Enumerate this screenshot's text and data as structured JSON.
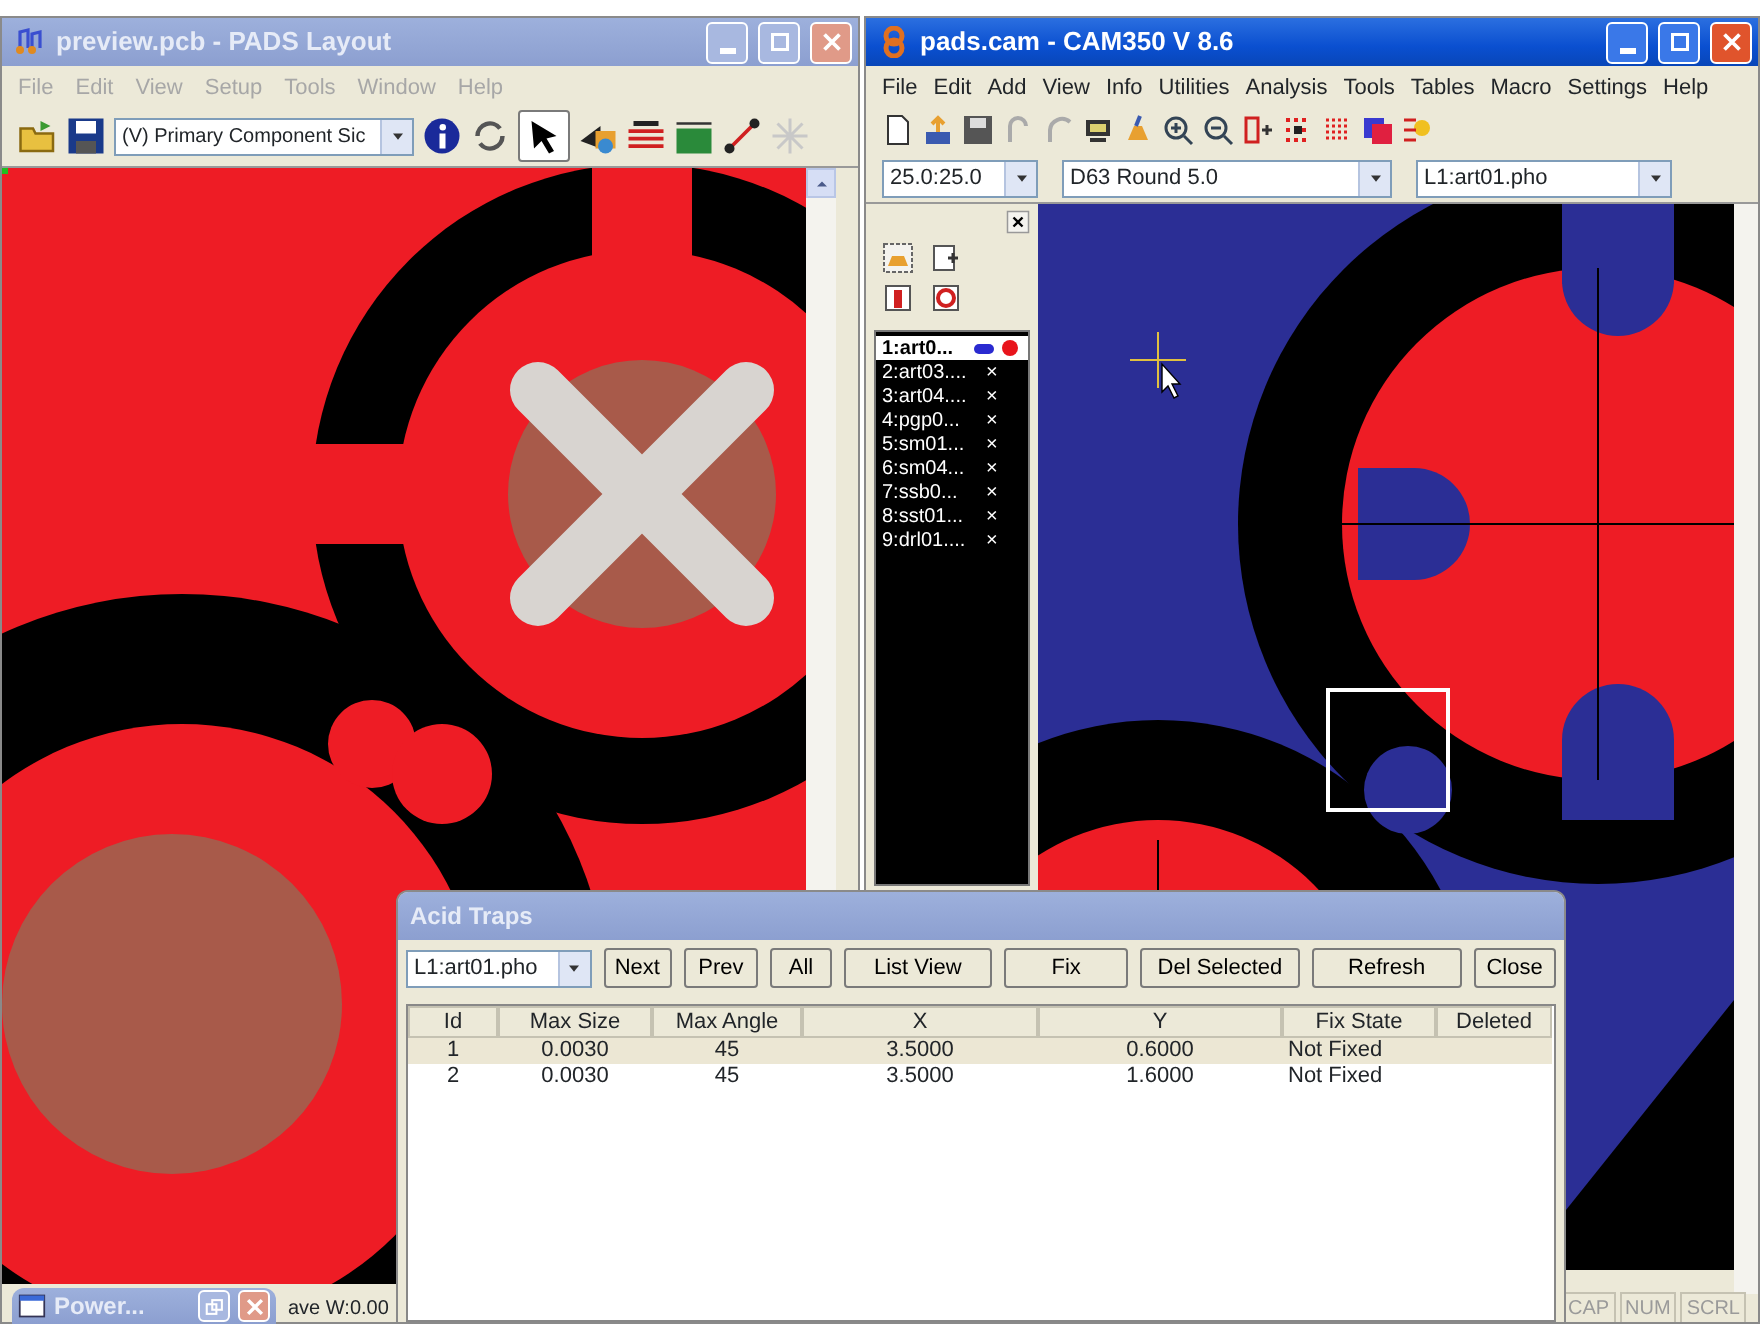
{
  "pads_window": {
    "title": "preview.pcb - PADS Layout",
    "active": false,
    "menu": [
      "File",
      "Edit",
      "View",
      "Setup",
      "Tools",
      "Window",
      "Help"
    ],
    "layer_select": "(V) Primary Component Sic",
    "status_text": "ave W:0.00"
  },
  "cam_window": {
    "title": "pads.cam - CAM350 V 8.6",
    "active": true,
    "menu": [
      "File",
      "Edit",
      "Add",
      "View",
      "Info",
      "Utilities",
      "Analysis",
      "Tools",
      "Tables",
      "Macro",
      "Settings",
      "Help"
    ],
    "grid_select": "25.0:25.0",
    "aperture_select": "D63  Round 5.0",
    "layer_select": "L1:art01.pho",
    "layers": [
      {
        "label": "1:art0...",
        "selected": true,
        "kind": "shown",
        "color": "#e8141c"
      },
      {
        "label": "2:art03....",
        "selected": false,
        "kind": "hidden",
        "mark": "×"
      },
      {
        "label": "3:art04....",
        "selected": false,
        "kind": "hidden",
        "mark": "×"
      },
      {
        "label": "4:pgp0...",
        "selected": false,
        "kind": "hidden",
        "mark": "×"
      },
      {
        "label": "5:sm01...",
        "selected": false,
        "kind": "hidden",
        "mark": "×"
      },
      {
        "label": "6:sm04...",
        "selected": false,
        "kind": "hidden",
        "mark": "×"
      },
      {
        "label": "7:ssb0...",
        "selected": false,
        "kind": "hidden",
        "mark": "×"
      },
      {
        "label": "8:sst01...",
        "selected": false,
        "kind": "hidden",
        "mark": "×"
      },
      {
        "label": "9:drl01....",
        "selected": false,
        "kind": "hidden",
        "mark": "×"
      }
    ],
    "status_indicators": [
      "CAP",
      "NUM",
      "SCRL"
    ]
  },
  "acid_traps_dialog": {
    "title": "Acid Traps",
    "layer_select": "L1:art01.pho",
    "buttons": [
      "Next",
      "Prev",
      "All",
      "List View",
      "Fix",
      "Del Selected",
      "Refresh",
      "Close"
    ],
    "columns": [
      "Id",
      "Max Size",
      "Max Angle",
      "X",
      "Y",
      "Fix State",
      "Deleted"
    ],
    "rows": [
      {
        "cells": [
          "1",
          "0.0030",
          "45",
          "3.5000",
          "0.6000",
          "Not Fixed",
          ""
        ],
        "selected": true
      },
      {
        "cells": [
          "2",
          "0.0030",
          "45",
          "3.5000",
          "1.6000",
          "Not Fixed",
          ""
        ],
        "selected": false
      }
    ]
  },
  "minimized_window": {
    "title": "Power..."
  }
}
